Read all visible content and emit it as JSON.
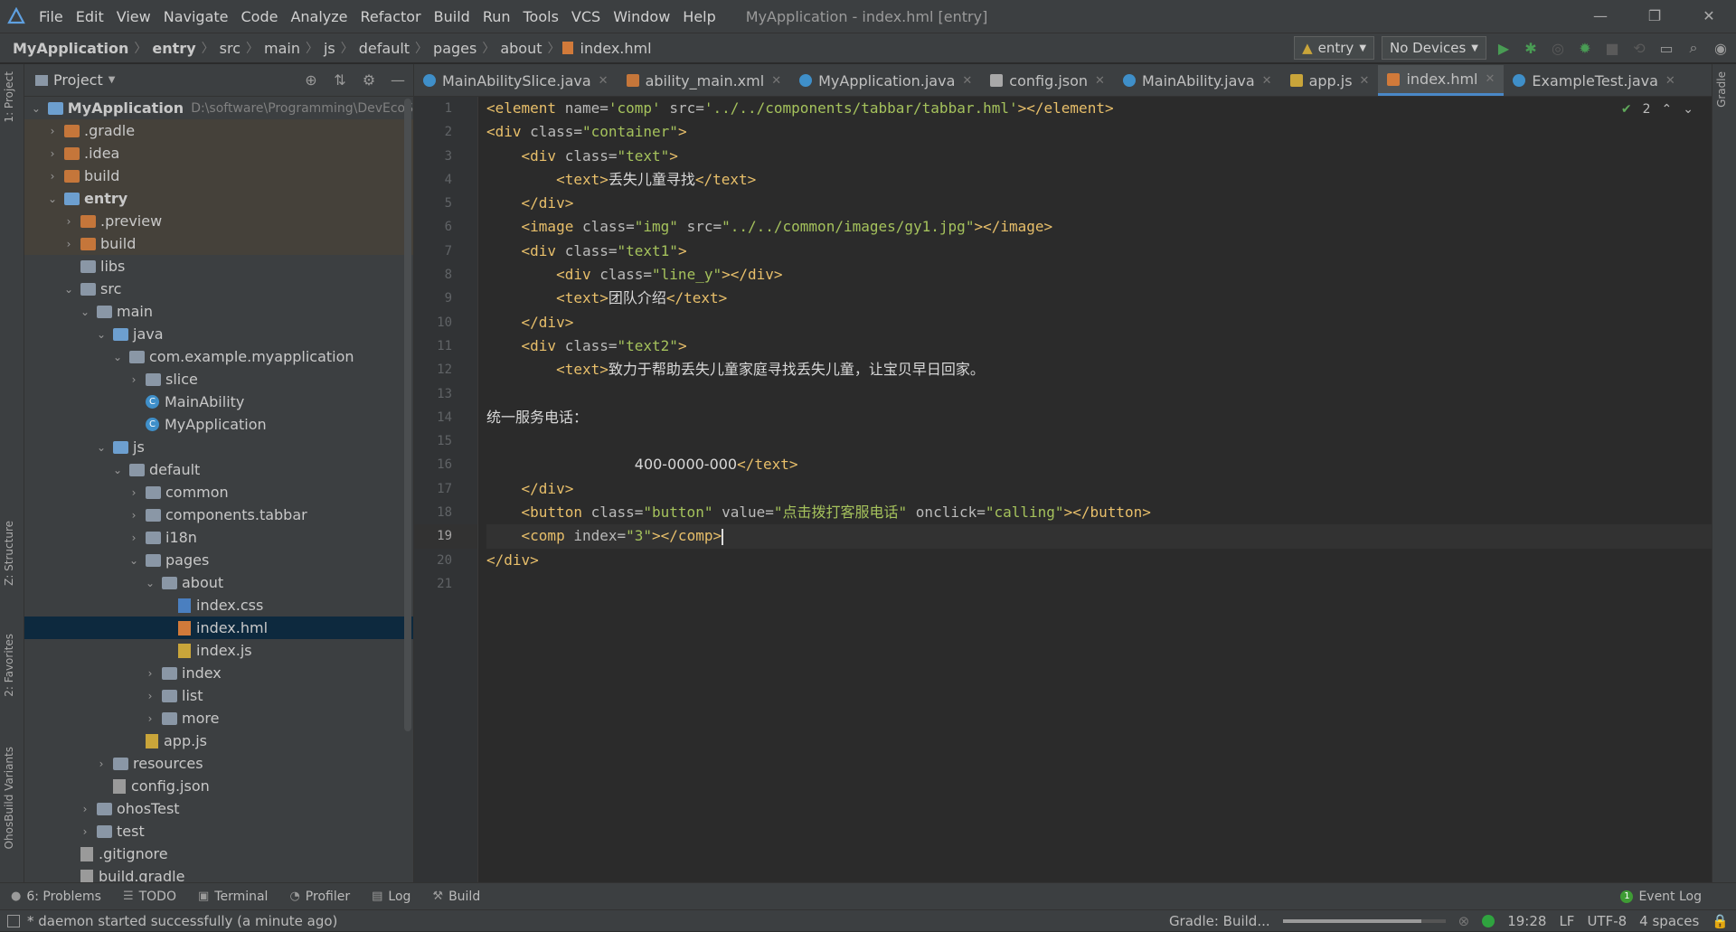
{
  "menubar": {
    "items": [
      "File",
      "Edit",
      "View",
      "Navigate",
      "Code",
      "Analyze",
      "Refactor",
      "Build",
      "Run",
      "Tools",
      "VCS",
      "Window",
      "Help"
    ],
    "window_title": "MyApplication - index.hml [entry]"
  },
  "navbar": {
    "crumbs": [
      "MyApplication",
      "entry",
      "src",
      "main",
      "js",
      "default",
      "pages",
      "about",
      "index.hml"
    ],
    "config": "entry",
    "device": "No Devices"
  },
  "leftstrip": {
    "project": "1: Project",
    "structure": "Z: Structure",
    "favorites": "2: Favorites",
    "variants": "OhosBuild Variants"
  },
  "rightstrip": {
    "gradle": "Gradle"
  },
  "project": {
    "title": "Project",
    "tree": [
      {
        "label": "MyApplication",
        "path": "D:\\software\\Programming\\DevEcoS",
        "depth": 0,
        "open": true,
        "icon": "folder-blue",
        "bold": true
      },
      {
        "label": ".gradle",
        "depth": 1,
        "open": false,
        "icon": "folder-orange",
        "mod": true
      },
      {
        "label": ".idea",
        "depth": 1,
        "open": false,
        "icon": "folder-orange",
        "mod": true
      },
      {
        "label": "build",
        "depth": 1,
        "open": false,
        "icon": "folder-orange",
        "mod": true
      },
      {
        "label": "entry",
        "depth": 1,
        "open": true,
        "icon": "folder-blue",
        "bold": true,
        "mod": true
      },
      {
        "label": ".preview",
        "depth": 2,
        "open": false,
        "icon": "folder-orange",
        "mod": true
      },
      {
        "label": "build",
        "depth": 2,
        "open": false,
        "icon": "folder-orange",
        "mod": true
      },
      {
        "label": "libs",
        "depth": 2,
        "icon": "folder"
      },
      {
        "label": "src",
        "depth": 2,
        "open": true,
        "icon": "folder"
      },
      {
        "label": "main",
        "depth": 3,
        "open": true,
        "icon": "folder"
      },
      {
        "label": "java",
        "depth": 4,
        "open": true,
        "icon": "folder-blue"
      },
      {
        "label": "com.example.myapplication",
        "depth": 5,
        "open": true,
        "icon": "folder"
      },
      {
        "label": "slice",
        "depth": 6,
        "open": false,
        "icon": "folder"
      },
      {
        "label": "MainAbility",
        "depth": 6,
        "icon": "class"
      },
      {
        "label": "MyApplication",
        "depth": 6,
        "icon": "class"
      },
      {
        "label": "js",
        "depth": 4,
        "open": true,
        "icon": "folder-blue"
      },
      {
        "label": "default",
        "depth": 5,
        "open": true,
        "icon": "folder"
      },
      {
        "label": "common",
        "depth": 6,
        "open": false,
        "icon": "folder"
      },
      {
        "label": "components.tabbar",
        "depth": 6,
        "open": false,
        "icon": "folder"
      },
      {
        "label": "i18n",
        "depth": 6,
        "open": false,
        "icon": "folder"
      },
      {
        "label": "pages",
        "depth": 6,
        "open": true,
        "icon": "folder"
      },
      {
        "label": "about",
        "depth": 7,
        "open": true,
        "icon": "folder"
      },
      {
        "label": "index.css",
        "depth": 8,
        "icon": "css"
      },
      {
        "label": "index.hml",
        "depth": 8,
        "icon": "hml",
        "selected": true
      },
      {
        "label": "index.js",
        "depth": 8,
        "icon": "js"
      },
      {
        "label": "index",
        "depth": 7,
        "open": false,
        "icon": "folder"
      },
      {
        "label": "list",
        "depth": 7,
        "open": false,
        "icon": "folder"
      },
      {
        "label": "more",
        "depth": 7,
        "open": false,
        "icon": "folder"
      },
      {
        "label": "app.js",
        "depth": 6,
        "icon": "js"
      },
      {
        "label": "resources",
        "depth": 4,
        "open": false,
        "icon": "folder"
      },
      {
        "label": "config.json",
        "depth": 4,
        "icon": "json"
      },
      {
        "label": "ohosTest",
        "depth": 3,
        "open": false,
        "icon": "folder"
      },
      {
        "label": "test",
        "depth": 3,
        "open": false,
        "icon": "folder"
      },
      {
        "label": ".gitignore",
        "depth": 2,
        "icon": "json"
      },
      {
        "label": "build.gradle",
        "depth": 2,
        "icon": "json"
      }
    ]
  },
  "editor": {
    "tabs": [
      {
        "label": "MainAbilitySlice.java",
        "icon": "class"
      },
      {
        "label": "ability_main.xml",
        "icon": "xml"
      },
      {
        "label": "MyApplication.java",
        "icon": "class"
      },
      {
        "label": "config.json",
        "icon": "sq"
      },
      {
        "label": "MainAbility.java",
        "icon": "class"
      },
      {
        "label": "app.js",
        "icon": "js"
      },
      {
        "label": "index.hml",
        "icon": "hml",
        "active": true
      },
      {
        "label": "ExampleTest.java",
        "icon": "class"
      }
    ],
    "inspection_count": "2",
    "current_line": 19,
    "lines": [
      [
        [
          "t",
          "<element "
        ],
        [
          "a",
          "name="
        ],
        [
          "s",
          "'comp' "
        ],
        [
          "a",
          "src="
        ],
        [
          "s",
          "'../../components/tabbar/tabbar.hml'"
        ],
        [
          "t",
          "></element>"
        ]
      ],
      [
        [
          "t",
          "<div "
        ],
        [
          "a",
          "class="
        ],
        [
          "s",
          "\"container\""
        ],
        [
          "t",
          ">"
        ]
      ],
      [
        [
          "p",
          "    "
        ],
        [
          "t",
          "<div "
        ],
        [
          "a",
          "class="
        ],
        [
          "s",
          "\"text\""
        ],
        [
          "t",
          ">"
        ]
      ],
      [
        [
          "p",
          "        "
        ],
        [
          "t",
          "<text>"
        ],
        [
          "x",
          "丢失儿童寻找"
        ],
        [
          "t",
          "</text>"
        ]
      ],
      [
        [
          "p",
          "    "
        ],
        [
          "t",
          "</div>"
        ]
      ],
      [
        [
          "p",
          "    "
        ],
        [
          "t",
          "<image "
        ],
        [
          "a",
          "class="
        ],
        [
          "s",
          "\"img\" "
        ],
        [
          "a",
          "src="
        ],
        [
          "s",
          "\"../../common/images/gy1.jpg\""
        ],
        [
          "t",
          "></image>"
        ]
      ],
      [
        [
          "p",
          "    "
        ],
        [
          "t",
          "<div "
        ],
        [
          "a",
          "class="
        ],
        [
          "s",
          "\"text1\""
        ],
        [
          "t",
          ">"
        ]
      ],
      [
        [
          "p",
          "        "
        ],
        [
          "t",
          "<div "
        ],
        [
          "a",
          "class="
        ],
        [
          "s",
          "\"line_y\""
        ],
        [
          "t",
          "></div>"
        ]
      ],
      [
        [
          "p",
          "        "
        ],
        [
          "t",
          "<text>"
        ],
        [
          "x",
          "团队介绍"
        ],
        [
          "t",
          "</text>"
        ]
      ],
      [
        [
          "p",
          "    "
        ],
        [
          "t",
          "</div>"
        ]
      ],
      [
        [
          "p",
          "    "
        ],
        [
          "t",
          "<div "
        ],
        [
          "a",
          "class="
        ],
        [
          "s",
          "\"text2\""
        ],
        [
          "t",
          ">"
        ]
      ],
      [
        [
          "p",
          "        "
        ],
        [
          "t",
          "<text>"
        ],
        [
          "x",
          "致力于帮助丢失儿童家庭寻找丢失儿童，让宝贝早日回家。"
        ]
      ],
      [],
      [
        [
          "x",
          "统一服务电话："
        ]
      ],
      [],
      [
        [
          "p",
          "                 "
        ],
        [
          "x",
          "400-0000-000"
        ],
        [
          "t",
          "</text>"
        ]
      ],
      [
        [
          "p",
          "    "
        ],
        [
          "t",
          "</div>"
        ]
      ],
      [
        [
          "p",
          "    "
        ],
        [
          "t",
          "<button "
        ],
        [
          "a",
          "class="
        ],
        [
          "s",
          "\"button\" "
        ],
        [
          "a",
          "value="
        ],
        [
          "s",
          "\"点击拨打客服电话\" "
        ],
        [
          "a",
          "onclick="
        ],
        [
          "s",
          "\"calling\""
        ],
        [
          "t",
          "></button>"
        ]
      ],
      [
        [
          "p",
          "    "
        ],
        [
          "t",
          "<comp "
        ],
        [
          "a",
          "index="
        ],
        [
          "s",
          "\"3\""
        ],
        [
          "t",
          "></comp>"
        ],
        [
          "c",
          ""
        ]
      ],
      [
        [
          "t",
          "</div>"
        ]
      ],
      []
    ]
  },
  "toolwindows": {
    "problems": "6: Problems",
    "todo": "TODO",
    "terminal": "Terminal",
    "profiler": "Profiler",
    "log": "Log",
    "build": "Build",
    "event_log": "Event Log",
    "event_count": "1"
  },
  "status": {
    "message": "* daemon started successfully (a minute ago)",
    "task": "Gradle: Build...",
    "progress": 0.85,
    "time": "19:28",
    "line_sep": "LF",
    "encoding": "UTF-8",
    "indent": "4 spaces"
  }
}
